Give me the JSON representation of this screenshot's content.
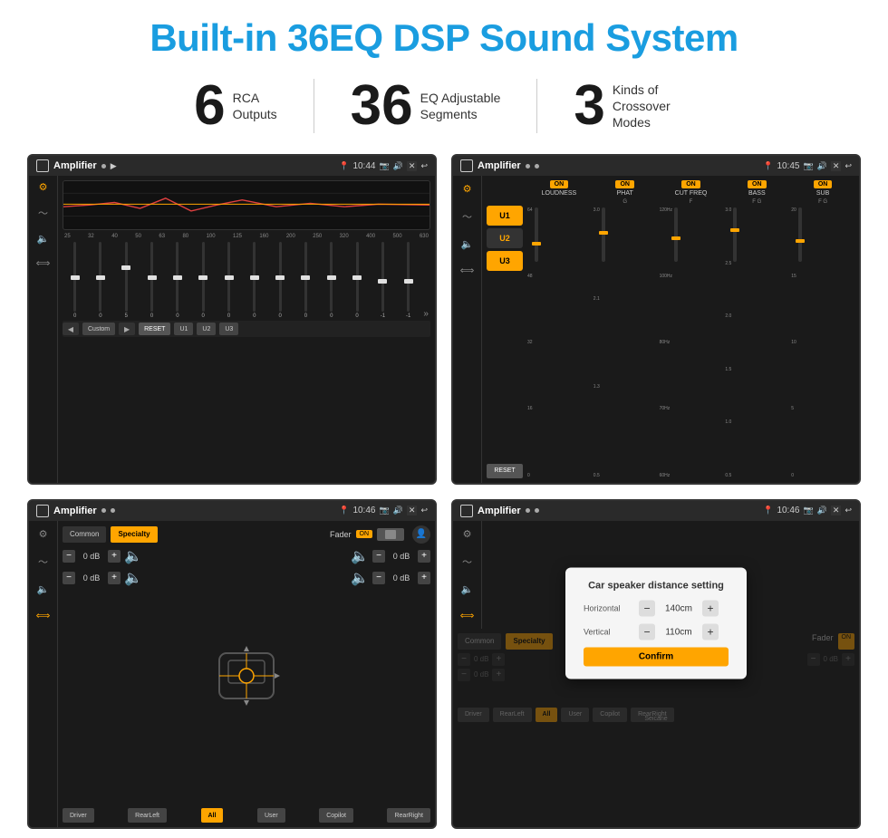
{
  "page": {
    "title": "Built-in 36EQ DSP Sound System",
    "stats": [
      {
        "number": "6",
        "text": "RCA\nOutputs"
      },
      {
        "number": "36",
        "text": "EQ Adjustable\nSegments"
      },
      {
        "number": "3",
        "text": "Kinds of\nCrossover Modes"
      }
    ],
    "screens": {
      "eq": {
        "title": "Amplifier",
        "time": "10:44",
        "freqs": [
          "25",
          "32",
          "40",
          "50",
          "63",
          "80",
          "100",
          "125",
          "160",
          "200",
          "250",
          "320",
          "400",
          "500",
          "630"
        ],
        "sliderValues": [
          "0",
          "0",
          "5",
          "0",
          "0",
          "0",
          "0",
          "0",
          "0",
          "0",
          "0",
          "0",
          "-1",
          "-1"
        ],
        "mode": "Custom",
        "buttons": [
          "RESET",
          "U1",
          "U2",
          "U3"
        ]
      },
      "crossover": {
        "title": "Amplifier",
        "time": "10:45",
        "uButtons": [
          "U1",
          "U2",
          "U3"
        ],
        "sections": [
          {
            "label": "LOUDNESS",
            "on": true
          },
          {
            "label": "PHAT",
            "on": true
          },
          {
            "label": "CUT FREQ",
            "on": true
          },
          {
            "label": "BASS",
            "on": true
          },
          {
            "label": "SUB",
            "on": true
          }
        ]
      },
      "fader": {
        "title": "Amplifier",
        "time": "10:46",
        "tabs": [
          "Common",
          "Specialty"
        ],
        "activeTab": "Specialty",
        "faderLabel": "Fader",
        "faderOn": "ON",
        "channels": [
          {
            "label": "left-front",
            "value": "0 dB"
          },
          {
            "label": "left-rear",
            "value": "0 dB"
          },
          {
            "label": "right-front",
            "value": "0 dB"
          },
          {
            "label": "right-rear",
            "value": "0 dB"
          }
        ],
        "bottomButtons": [
          "Driver",
          "RearLeft",
          "All",
          "User",
          "Copilot",
          "RearRight"
        ]
      },
      "distance": {
        "title": "Amplifier",
        "time": "10:46",
        "dialog": {
          "title": "Car speaker distance setting",
          "horizontal": {
            "label": "Horizontal",
            "value": "140cm"
          },
          "vertical": {
            "label": "Vertical",
            "value": "110cm"
          },
          "confirmLabel": "Confirm"
        },
        "tabs": [
          "Common",
          "Specialty"
        ],
        "faderOn": "ON",
        "bottomButtons": [
          "Driver",
          "RearLeft",
          "All",
          "User",
          "Copilot",
          "RearRight"
        ]
      }
    }
  }
}
